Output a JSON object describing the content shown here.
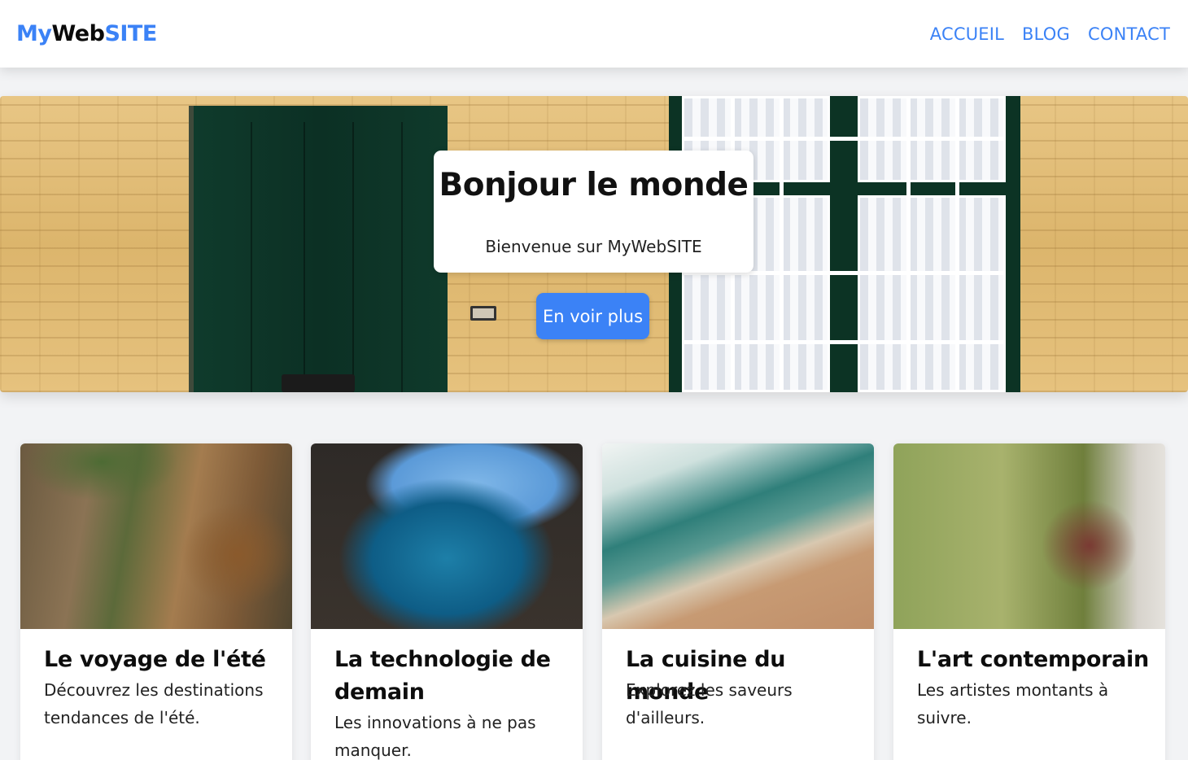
{
  "navbar": {
    "brand": {
      "part1": "My",
      "part2": "Web",
      "part3": "SITE"
    },
    "links": [
      {
        "label": "ACCUEIL"
      },
      {
        "label": "BLOG"
      },
      {
        "label": "CONTACT"
      }
    ]
  },
  "hero": {
    "title": "Bonjour le monde",
    "subtitle": "Bienvenue sur MyWebSITE",
    "button_label": "En voir plus"
  },
  "cards": [
    {
      "title": "Le voyage de l'été",
      "text": "Découvrez les destinations tendances de l'été."
    },
    {
      "title": "La technologie de demain",
      "text": "Les innovations à ne pas manquer."
    },
    {
      "title": "La cuisine du monde",
      "text": "Explorez les saveurs d'ailleurs."
    },
    {
      "title": "L'art contemporain",
      "text": "Les artistes montants à suivre."
    }
  ],
  "colors": {
    "accent": "#3b82f6",
    "background": "#f2f3f5",
    "card_background": "#ffffff"
  }
}
